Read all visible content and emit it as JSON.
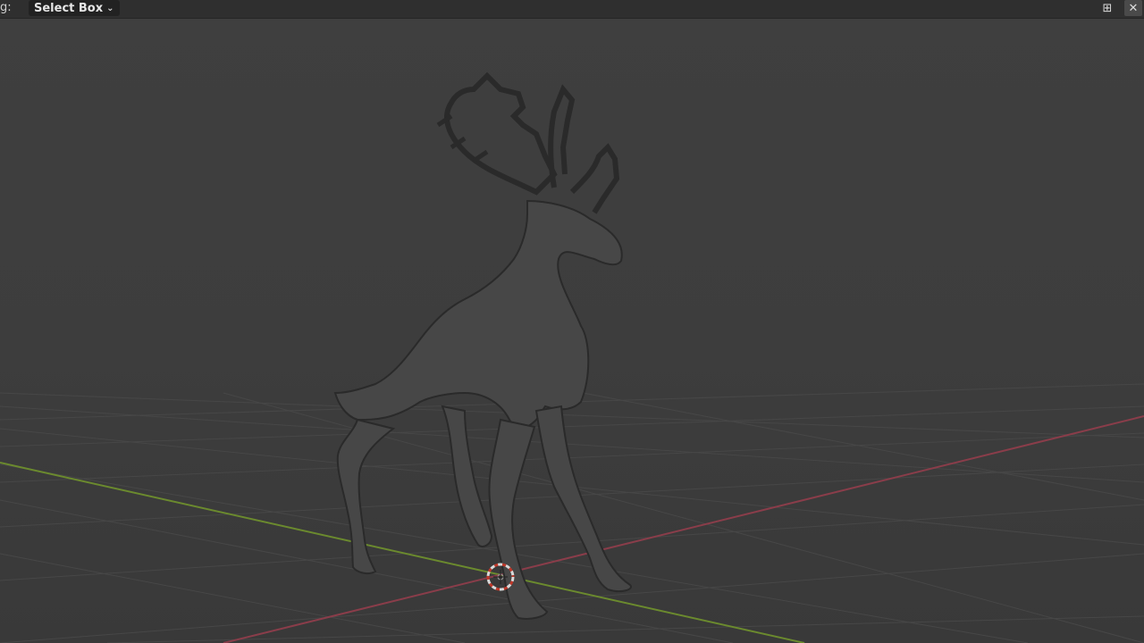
{
  "header": {
    "mode_label": "g:",
    "select_mode": "Select Box",
    "icons": [
      "transform-pivot-icon",
      "close-icon"
    ]
  },
  "viewport": {
    "object": "deer mesh",
    "x_axis_color": "#8a3d4a",
    "y_axis_color": "#6b8a2e",
    "grid_color": "#4a4a4a",
    "mesh_color": "#4a4a4a"
  }
}
